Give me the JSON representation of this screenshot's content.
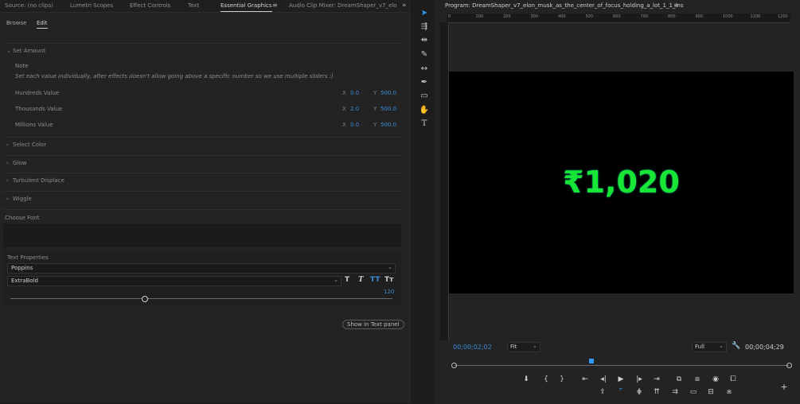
{
  "tabs": [
    {
      "label": "Source: (no clips)",
      "active": false
    },
    {
      "label": "Lumetri Scopes",
      "active": false
    },
    {
      "label": "Effect Controls",
      "active": false
    },
    {
      "label": "Text",
      "active": false
    },
    {
      "label": "Essential Graphics",
      "active": true
    },
    {
      "label": "Audio Clip Mixer: DreamShaper_v7_elo",
      "active": false
    }
  ],
  "overflow_glyph": "»",
  "panel_menu_glyph": "≡",
  "subtabs": {
    "browse": "Browse",
    "edit": "Edit"
  },
  "set_amount": {
    "title": "Set Amount",
    "note_label": "Note",
    "note_text": "Set each value individually, after effects doesn't allow going above a specific number so we use multiple sliders :)",
    "rows": [
      {
        "label": "Hundreds Value",
        "x_label": "X",
        "x": "0.0",
        "y_label": "Y",
        "y": "500.0"
      },
      {
        "label": "Thousands Value",
        "x_label": "X",
        "x": "2.0",
        "y_label": "Y",
        "y": "500.0"
      },
      {
        "label": "Millions Value",
        "x_label": "X",
        "x": "0.0",
        "y_label": "Y",
        "y": "500.0"
      }
    ]
  },
  "collapsed_sections": [
    "Select Color",
    "Glow",
    "Turbulent Displace",
    "Wiggle"
  ],
  "choose_font": "Choose Font",
  "text_properties": {
    "title": "Text Properties",
    "font_family": "Poppins",
    "font_style": "ExtraBold",
    "size_value": "120",
    "size_fraction": 0.35
  },
  "show_in_text_panel": "Show in Text panel",
  "program": {
    "title": "Program: DreamShaper_v7_elon_musk_as_the_center_of_focus_holding_a_lot_1_1_ins",
    "video_text": "₹1,020",
    "timecode_current": "00;00;02;02",
    "fit": "Fit",
    "quality": "Full",
    "timecode_duration": "00;00;04;29",
    "playhead_fraction": 0.41,
    "ruler_ticks": [
      "0",
      "100",
      "200",
      "300",
      "400",
      "500",
      "600",
      "700",
      "800",
      "900",
      "1000",
      "1100",
      "1200"
    ]
  },
  "colors": {
    "accent": "#2f9bf5",
    "video_text": "#17e636"
  }
}
